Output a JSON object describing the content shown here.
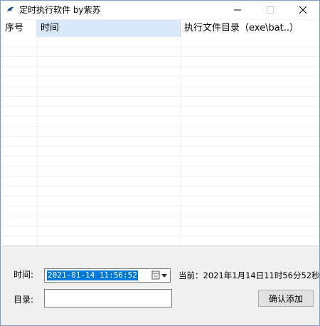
{
  "window": {
    "title": "定时执行软件 by紫苏",
    "icon": "app-fin-icon",
    "controls": [
      "minimize-icon",
      "maximize-icon",
      "close-icon"
    ]
  },
  "list": {
    "columns": [
      "序号",
      "时间",
      "执行文件目录（exe\\bat..）"
    ],
    "rows": []
  },
  "form": {
    "time_label": "时间:",
    "time_value": "2021-01-14 11:56:52",
    "current_label": "当前：2021年1月14日11时56分52秒",
    "dir_label": "目录:",
    "dir_value": "",
    "add_button": "确认添加"
  },
  "colors": {
    "selected_header": "#d9e8fb",
    "selection": "#0078d7",
    "panel": "#f0f0f0"
  }
}
